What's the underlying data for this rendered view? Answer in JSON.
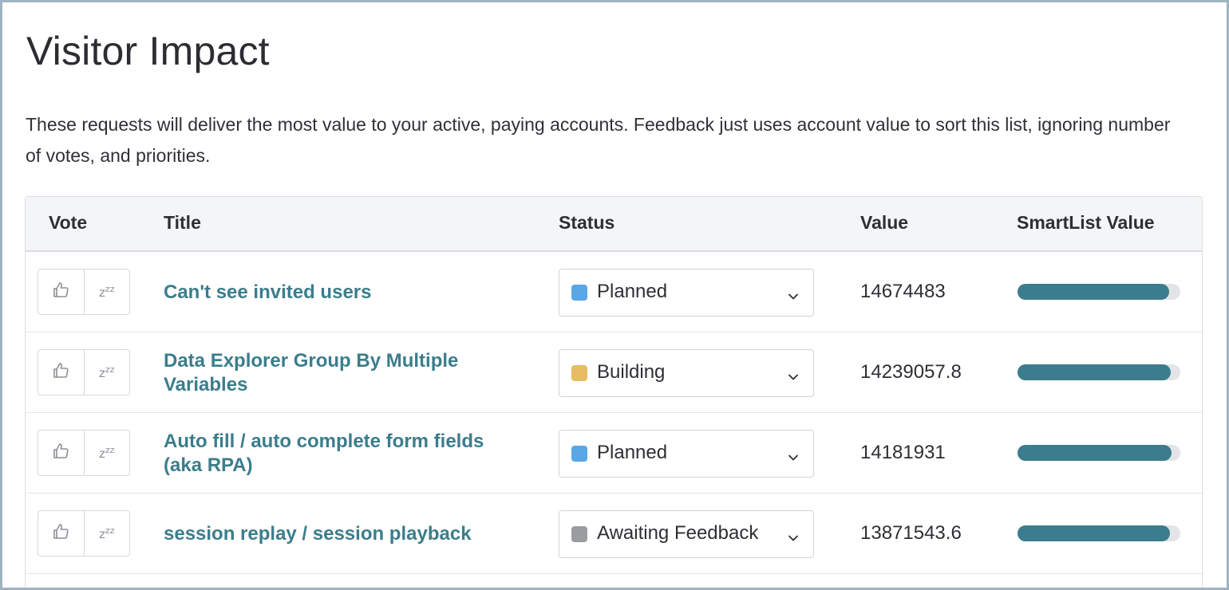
{
  "page": {
    "title": "Visitor Impact",
    "description": "These requests will deliver the most value to your active, paying accounts. Feedback just uses account value to sort this list, ignoring number of votes, and priorities."
  },
  "table": {
    "headers": {
      "vote": "Vote",
      "title": "Title",
      "status": "Status",
      "value": "Value",
      "smartlist": "SmartList Value"
    },
    "icons": {
      "upvote": "thumbs-up-icon",
      "snooze": "zzz-snooze-icon",
      "dropdown": "chevron-down-icon"
    },
    "rows": [
      {
        "title": "Can't see invited users",
        "status": "Planned",
        "status_color": "#5aa6e6",
        "value": "14674483",
        "smartlist_fraction": 0.93
      },
      {
        "title": "Data Explorer Group By Multiple Variables",
        "status": "Building",
        "status_color": "#e6bd62",
        "value": "14239057.8",
        "smartlist_fraction": 0.94
      },
      {
        "title": "Auto fill / auto complete form fields (aka RPA)",
        "status": "Planned",
        "status_color": "#5aa6e6",
        "value": "14181931",
        "smartlist_fraction": 0.945
      },
      {
        "title": "session replay / session playback",
        "status": "Awaiting Feedback",
        "status_color": "#9a9ca0",
        "value": "13871543.6",
        "smartlist_fraction": 0.935
      }
    ]
  }
}
